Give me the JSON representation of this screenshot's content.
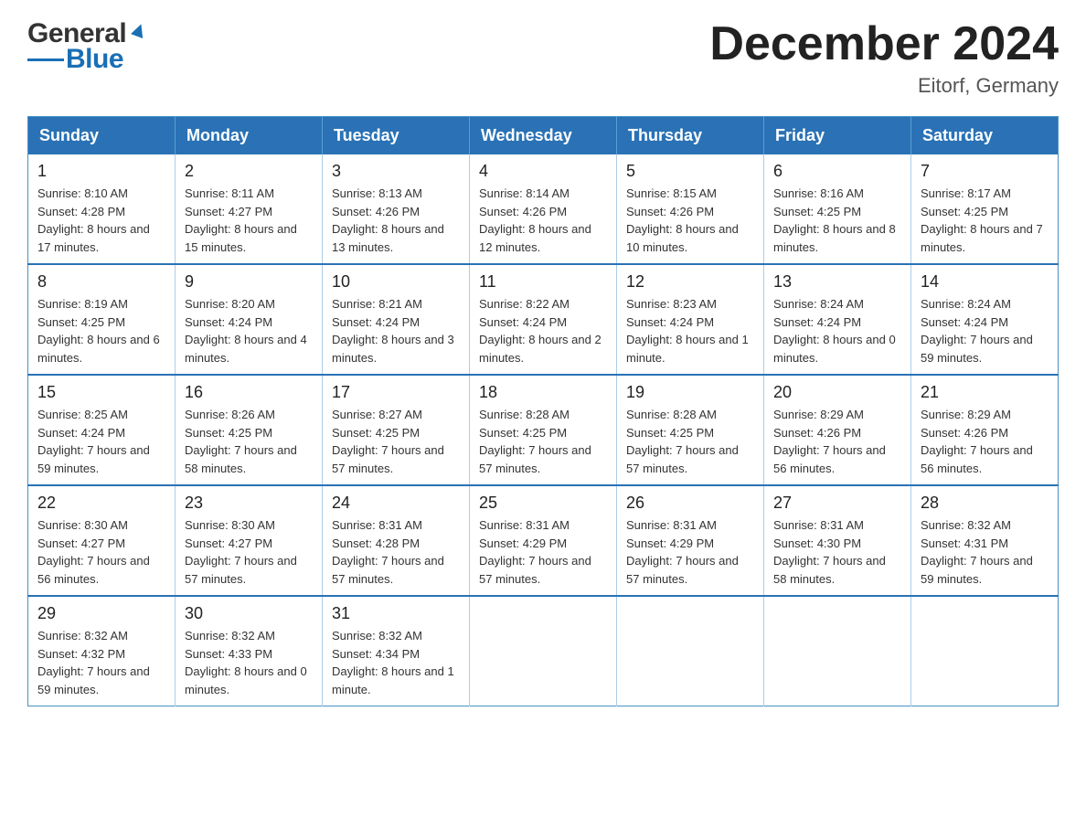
{
  "header": {
    "logo_general": "General",
    "logo_blue": "Blue",
    "month_title": "December 2024",
    "location": "Eitorf, Germany"
  },
  "days_of_week": [
    "Sunday",
    "Monday",
    "Tuesday",
    "Wednesday",
    "Thursday",
    "Friday",
    "Saturday"
  ],
  "weeks": [
    [
      {
        "day": "1",
        "sunrise": "8:10 AM",
        "sunset": "4:28 PM",
        "daylight": "8 hours and 17 minutes."
      },
      {
        "day": "2",
        "sunrise": "8:11 AM",
        "sunset": "4:27 PM",
        "daylight": "8 hours and 15 minutes."
      },
      {
        "day": "3",
        "sunrise": "8:13 AM",
        "sunset": "4:26 PM",
        "daylight": "8 hours and 13 minutes."
      },
      {
        "day": "4",
        "sunrise": "8:14 AM",
        "sunset": "4:26 PM",
        "daylight": "8 hours and 12 minutes."
      },
      {
        "day": "5",
        "sunrise": "8:15 AM",
        "sunset": "4:26 PM",
        "daylight": "8 hours and 10 minutes."
      },
      {
        "day": "6",
        "sunrise": "8:16 AM",
        "sunset": "4:25 PM",
        "daylight": "8 hours and 8 minutes."
      },
      {
        "day": "7",
        "sunrise": "8:17 AM",
        "sunset": "4:25 PM",
        "daylight": "8 hours and 7 minutes."
      }
    ],
    [
      {
        "day": "8",
        "sunrise": "8:19 AM",
        "sunset": "4:25 PM",
        "daylight": "8 hours and 6 minutes."
      },
      {
        "day": "9",
        "sunrise": "8:20 AM",
        "sunset": "4:24 PM",
        "daylight": "8 hours and 4 minutes."
      },
      {
        "day": "10",
        "sunrise": "8:21 AM",
        "sunset": "4:24 PM",
        "daylight": "8 hours and 3 minutes."
      },
      {
        "day": "11",
        "sunrise": "8:22 AM",
        "sunset": "4:24 PM",
        "daylight": "8 hours and 2 minutes."
      },
      {
        "day": "12",
        "sunrise": "8:23 AM",
        "sunset": "4:24 PM",
        "daylight": "8 hours and 1 minute."
      },
      {
        "day": "13",
        "sunrise": "8:24 AM",
        "sunset": "4:24 PM",
        "daylight": "8 hours and 0 minutes."
      },
      {
        "day": "14",
        "sunrise": "8:24 AM",
        "sunset": "4:24 PM",
        "daylight": "7 hours and 59 minutes."
      }
    ],
    [
      {
        "day": "15",
        "sunrise": "8:25 AM",
        "sunset": "4:24 PM",
        "daylight": "7 hours and 59 minutes."
      },
      {
        "day": "16",
        "sunrise": "8:26 AM",
        "sunset": "4:25 PM",
        "daylight": "7 hours and 58 minutes."
      },
      {
        "day": "17",
        "sunrise": "8:27 AM",
        "sunset": "4:25 PM",
        "daylight": "7 hours and 57 minutes."
      },
      {
        "day": "18",
        "sunrise": "8:28 AM",
        "sunset": "4:25 PM",
        "daylight": "7 hours and 57 minutes."
      },
      {
        "day": "19",
        "sunrise": "8:28 AM",
        "sunset": "4:25 PM",
        "daylight": "7 hours and 57 minutes."
      },
      {
        "day": "20",
        "sunrise": "8:29 AM",
        "sunset": "4:26 PM",
        "daylight": "7 hours and 56 minutes."
      },
      {
        "day": "21",
        "sunrise": "8:29 AM",
        "sunset": "4:26 PM",
        "daylight": "7 hours and 56 minutes."
      }
    ],
    [
      {
        "day": "22",
        "sunrise": "8:30 AM",
        "sunset": "4:27 PM",
        "daylight": "7 hours and 56 minutes."
      },
      {
        "day": "23",
        "sunrise": "8:30 AM",
        "sunset": "4:27 PM",
        "daylight": "7 hours and 57 minutes."
      },
      {
        "day": "24",
        "sunrise": "8:31 AM",
        "sunset": "4:28 PM",
        "daylight": "7 hours and 57 minutes."
      },
      {
        "day": "25",
        "sunrise": "8:31 AM",
        "sunset": "4:29 PM",
        "daylight": "7 hours and 57 minutes."
      },
      {
        "day": "26",
        "sunrise": "8:31 AM",
        "sunset": "4:29 PM",
        "daylight": "7 hours and 57 minutes."
      },
      {
        "day": "27",
        "sunrise": "8:31 AM",
        "sunset": "4:30 PM",
        "daylight": "7 hours and 58 minutes."
      },
      {
        "day": "28",
        "sunrise": "8:32 AM",
        "sunset": "4:31 PM",
        "daylight": "7 hours and 59 minutes."
      }
    ],
    [
      {
        "day": "29",
        "sunrise": "8:32 AM",
        "sunset": "4:32 PM",
        "daylight": "7 hours and 59 minutes."
      },
      {
        "day": "30",
        "sunrise": "8:32 AM",
        "sunset": "4:33 PM",
        "daylight": "8 hours and 0 minutes."
      },
      {
        "day": "31",
        "sunrise": "8:32 AM",
        "sunset": "4:34 PM",
        "daylight": "8 hours and 1 minute."
      },
      null,
      null,
      null,
      null
    ]
  ],
  "labels": {
    "sunrise_prefix": "Sunrise: ",
    "sunset_prefix": "Sunset: ",
    "daylight_prefix": "Daylight: "
  }
}
